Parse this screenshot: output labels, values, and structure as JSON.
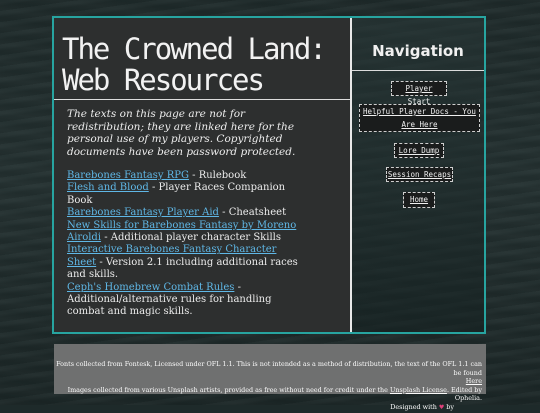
{
  "header": {
    "title_line1": "The Crowned Land:",
    "title_line2": "Web Resources"
  },
  "intro": "The texts on this page are not for redistribution; they are linked here for the personal use of my players. Copyrighted documents have been password protected.",
  "resources": [
    {
      "link": "Barebones Fantasy RPG",
      "desc": " - Rulebook"
    },
    {
      "link": "Flesh and Blood",
      "desc": " - Player Races Companion Book"
    },
    {
      "link": "Barebones Fantasy Player Aid",
      "desc": " - Cheatsheet"
    },
    {
      "link": "New Skills for Barebones Fantasy by Moreno Airoldi",
      "desc": " - Additional player character Skills"
    },
    {
      "link": "Interactive Barebones Fantasy Character Sheet",
      "desc": " - Version 2.1 including additional races and skills."
    },
    {
      "link": "Ceph's Homebrew Combat Rules",
      "desc": " - Additional/alternative rules for handling combat and magic skills."
    }
  ],
  "nav": {
    "title": "Navigation",
    "items": [
      "Player Start",
      "Helpful Player Docs - You Are Here",
      "Lore Dump",
      "Session Recaps",
      "Home"
    ]
  },
  "footer": {
    "line1": "Fonts collected from Fontesk, Licensed under OFL 1.1. This is not intended as a method of distribution, the text of the OFL 1.1 can be found",
    "line1_link": "Here",
    "line2_pre": "Images collected from various Unsplash artists, provided as free without need for credit under the",
    "line2_link": "Unsplash License",
    "line2_post": ". Edited by Ophelia.",
    "line3_pre": "Designed with",
    "line3_heart": "♥",
    "line3_post": "by"
  },
  "colors": {
    "accent_border": "#27a4a0",
    "link": "#5fb7e6",
    "panel": "#2d2f2f",
    "footer": "#6f7070"
  }
}
